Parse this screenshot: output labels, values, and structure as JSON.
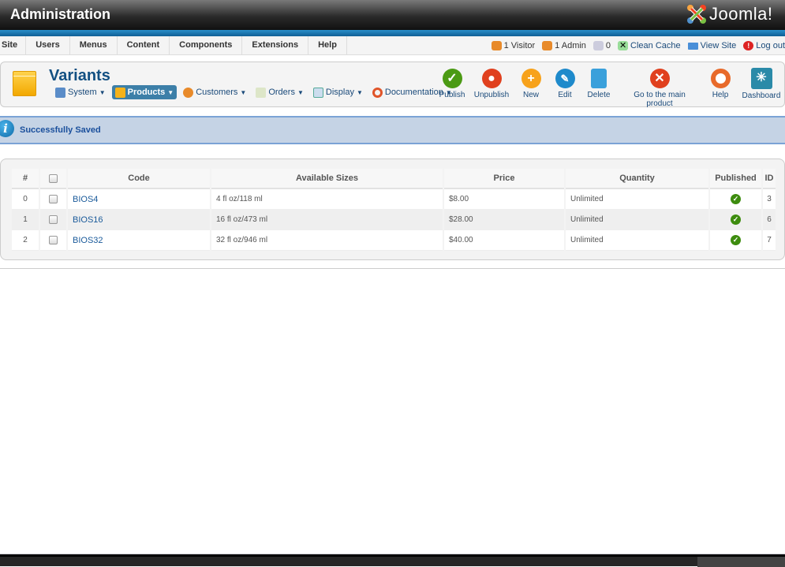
{
  "header": {
    "title": "Administration",
    "logo": "Joomla!"
  },
  "menu": [
    "Site",
    "Users",
    "Menus",
    "Content",
    "Components",
    "Extensions",
    "Help"
  ],
  "status": {
    "visitors": "1 Visitor",
    "admins": "1 Admin",
    "messages": "0",
    "clean_cache": "Clean Cache",
    "view_site": "View Site",
    "logout": "Log out"
  },
  "page": {
    "title": "Variants"
  },
  "submenu": [
    {
      "label": "System",
      "icon": "wrench-icon"
    },
    {
      "label": "Products",
      "icon": "box-icon",
      "active": true
    },
    {
      "label": "Customers",
      "icon": "users-icon"
    },
    {
      "label": "Orders",
      "icon": "orders-icon"
    },
    {
      "label": "Display",
      "icon": "display-icon"
    },
    {
      "label": "Documentation",
      "icon": "lifebuoy-icon"
    }
  ],
  "toolbar": {
    "publish": "Publish",
    "unpublish": "Unpublish",
    "new": "New",
    "edit": "Edit",
    "delete": "Delete",
    "main_product": "Go to the main product",
    "help": "Help",
    "dashboard": "Dashboard"
  },
  "message": "Successfully Saved",
  "table": {
    "headers": {
      "num": "#",
      "code": "Code",
      "sizes": "Available Sizes",
      "price": "Price",
      "quantity": "Quantity",
      "published": "Published",
      "id": "ID"
    },
    "rows": [
      {
        "num": "0",
        "code": "BIOS4",
        "sizes": "4 fl oz/118 ml",
        "price": "$8.00",
        "quantity": "Unlimited",
        "published": true,
        "id": "3"
      },
      {
        "num": "1",
        "code": "BIOS16",
        "sizes": "16 fl oz/473 ml",
        "price": "$28.00",
        "quantity": "Unlimited",
        "published": true,
        "id": "6"
      },
      {
        "num": "2",
        "code": "BIOS32",
        "sizes": "32 fl oz/946 ml",
        "price": "$40.00",
        "quantity": "Unlimited",
        "published": true,
        "id": "7"
      }
    ]
  },
  "colors": {
    "accent": "#135082",
    "message_bg": "#c5d3e5",
    "published": "#3d8c0e"
  }
}
